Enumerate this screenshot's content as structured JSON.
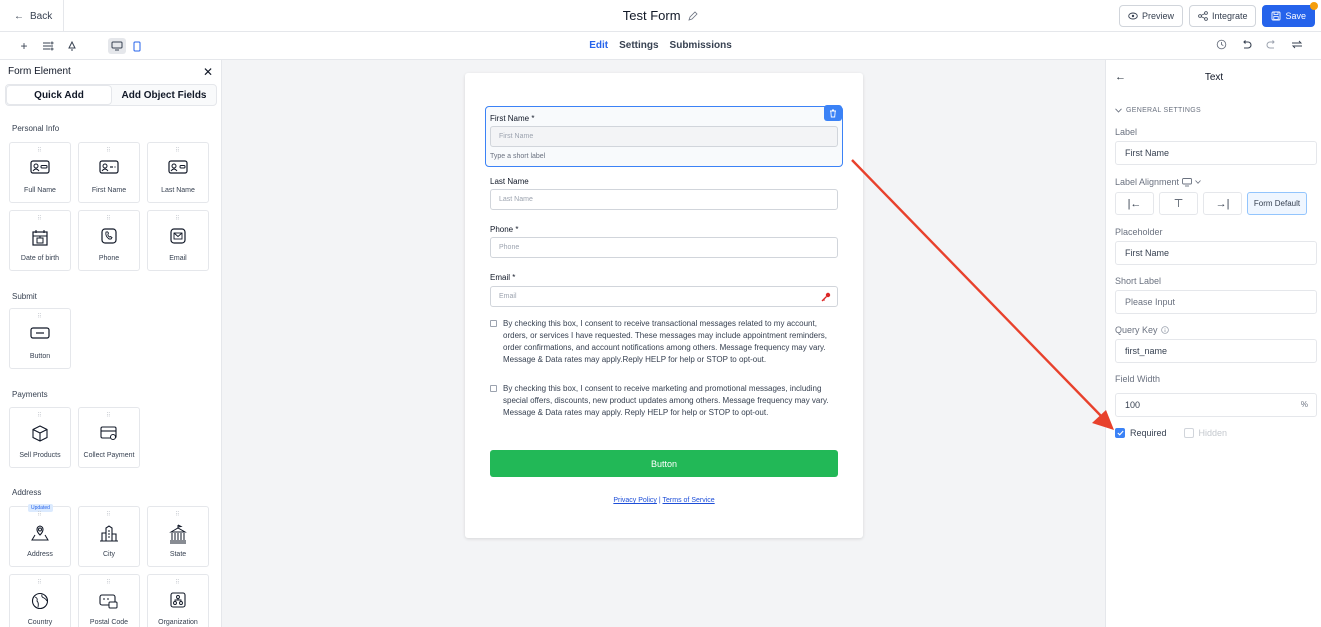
{
  "topbar": {
    "back_label": "Back",
    "title": "Test Form",
    "preview_label": "Preview",
    "integrate_label": "Integrate",
    "save_label": "Save"
  },
  "subbar": {
    "tabs": [
      "Edit",
      "Settings",
      "Submissions"
    ],
    "active_tab": "Edit"
  },
  "left_panel": {
    "title": "Form Element",
    "tabs": [
      "Quick Add",
      "Add Object Fields"
    ],
    "sections": {
      "personal": {
        "title": "Personal Info",
        "items": [
          "Full Name",
          "First Name",
          "Last Name",
          "Date of birth",
          "Phone",
          "Email"
        ]
      },
      "submit": {
        "title": "Submit",
        "items": [
          "Button"
        ]
      },
      "payments": {
        "title": "Payments",
        "items": [
          "Sell Products",
          "Collect Payment"
        ]
      },
      "address": {
        "title": "Address",
        "badge": "Updated",
        "items": [
          "Address",
          "City",
          "State",
          "Country",
          "Postal Code",
          "Organization"
        ]
      }
    }
  },
  "form": {
    "fields": [
      {
        "label": "First Name *",
        "placeholder": "First Name",
        "short_label": "Type a short label"
      },
      {
        "label": "Last Name",
        "placeholder": "Last Name"
      },
      {
        "label": "Phone *",
        "placeholder": "Phone"
      },
      {
        "label": "Email *",
        "placeholder": "Email"
      }
    ],
    "consent_transactional": "By checking this box, I consent to receive transactional messages related to my account, orders, or services I have requested. These messages may include appointment reminders, order confirmations, and account notifications among others. Message frequency may vary. Message & Data rates may apply.Reply HELP for help or STOP to opt-out.",
    "consent_marketing": "By checking this box, I consent to receive marketing and promotional messages, including special offers, discounts, new product updates among others. Message frequency may vary. Message & Data rates may apply. Reply HELP for help or STOP to opt-out.",
    "button_label": "Button",
    "privacy_label": "Privacy Policy",
    "terms_label": "Terms of Service",
    "link_separator": "|",
    "button_color": "#22b857"
  },
  "right_panel": {
    "title": "Text",
    "section": "GENERAL SETTINGS",
    "label_title": "Label",
    "label_value": "First Name",
    "alignment_title": "Label Alignment",
    "alignment_default": "Form Default",
    "placeholder_title": "Placeholder",
    "placeholder_value": "First Name",
    "short_label_title": "Short Label",
    "short_label_placeholder": "Please Input",
    "query_key_title": "Query Key",
    "query_key_value": "first_name",
    "field_width_title": "Field Width",
    "field_width_value": "100",
    "field_width_unit": "%",
    "required_label": "Required",
    "required_checked": true,
    "hidden_label": "Hidden",
    "hidden_checked": false
  },
  "colors": {
    "accent": "#2563eb",
    "annotation_arrow": "#e8412c"
  }
}
